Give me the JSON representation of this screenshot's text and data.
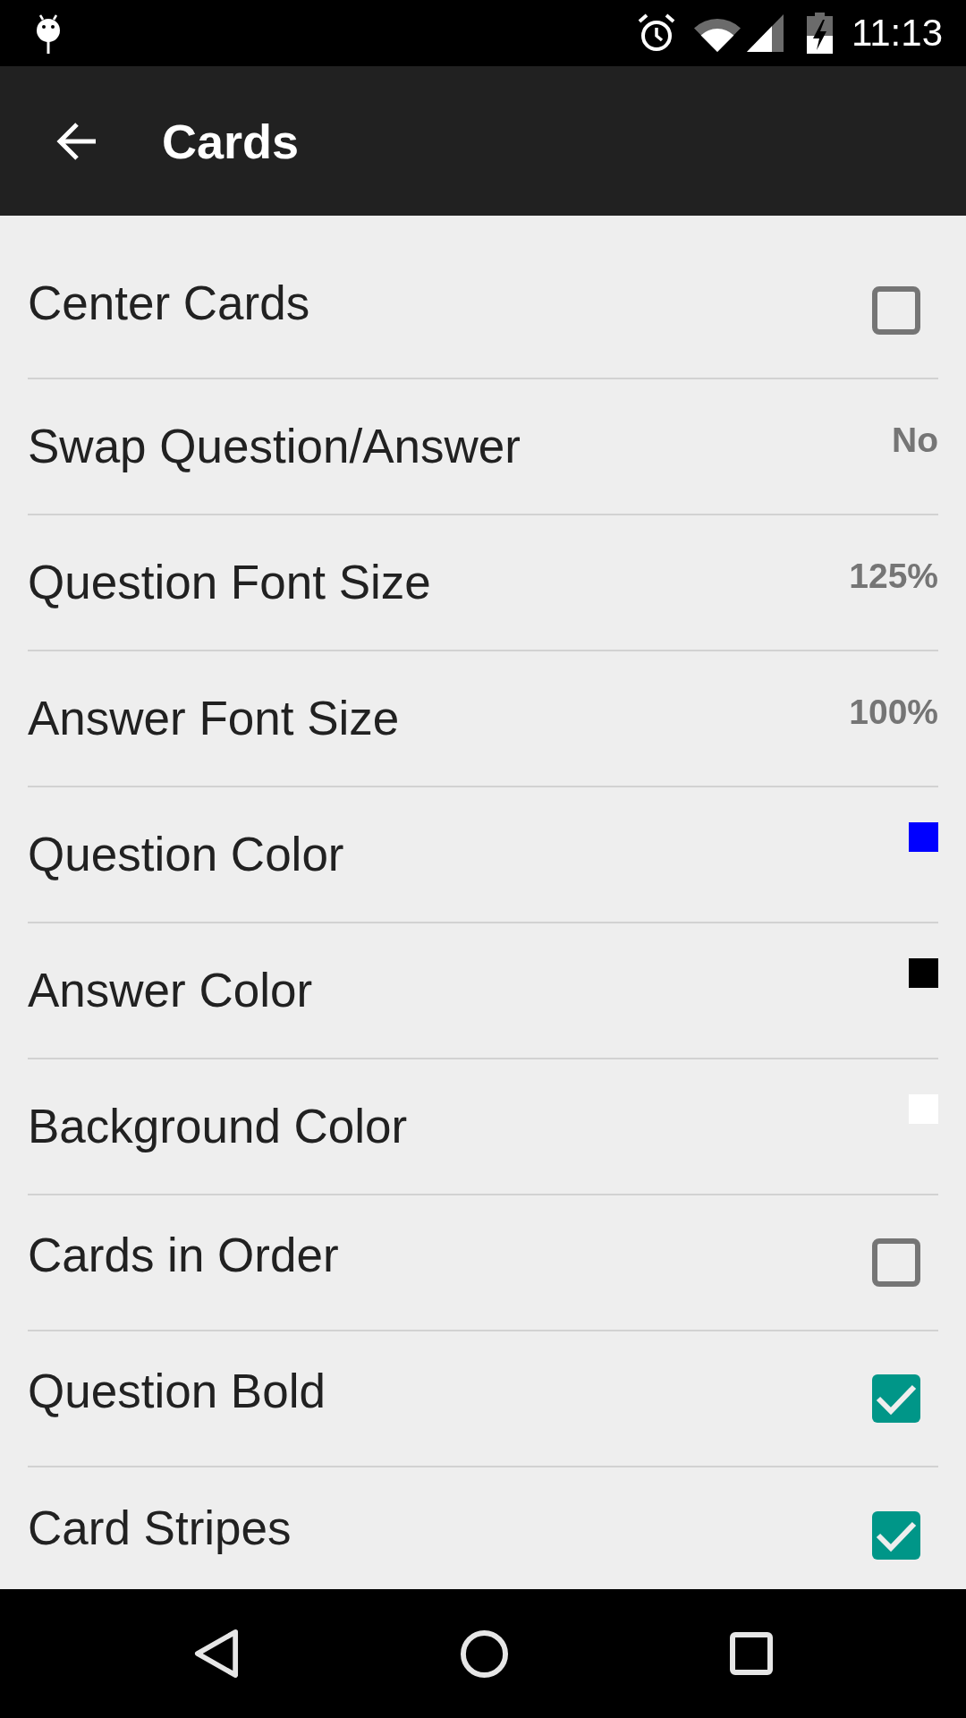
{
  "status_bar": {
    "time": "11:13"
  },
  "app_bar": {
    "title": "Cards"
  },
  "settings": [
    {
      "kind": "checkbox",
      "label": "Center Cards",
      "checked": false
    },
    {
      "kind": "value",
      "label": "Swap Question/Answer",
      "value": "No"
    },
    {
      "kind": "value",
      "label": "Question Font Size",
      "value": "125%"
    },
    {
      "kind": "value",
      "label": "Answer Font Size",
      "value": "100%"
    },
    {
      "kind": "color",
      "label": "Question Color",
      "color": "#0000ff"
    },
    {
      "kind": "color",
      "label": "Answer Color",
      "color": "#000000"
    },
    {
      "kind": "color",
      "label": "Background Color",
      "color": "#ffffff"
    },
    {
      "kind": "checkbox",
      "label": "Cards in Order",
      "checked": false
    },
    {
      "kind": "checkbox",
      "label": "Question Bold",
      "checked": true
    },
    {
      "kind": "checkbox",
      "label": "Card Stripes",
      "checked": true
    }
  ]
}
